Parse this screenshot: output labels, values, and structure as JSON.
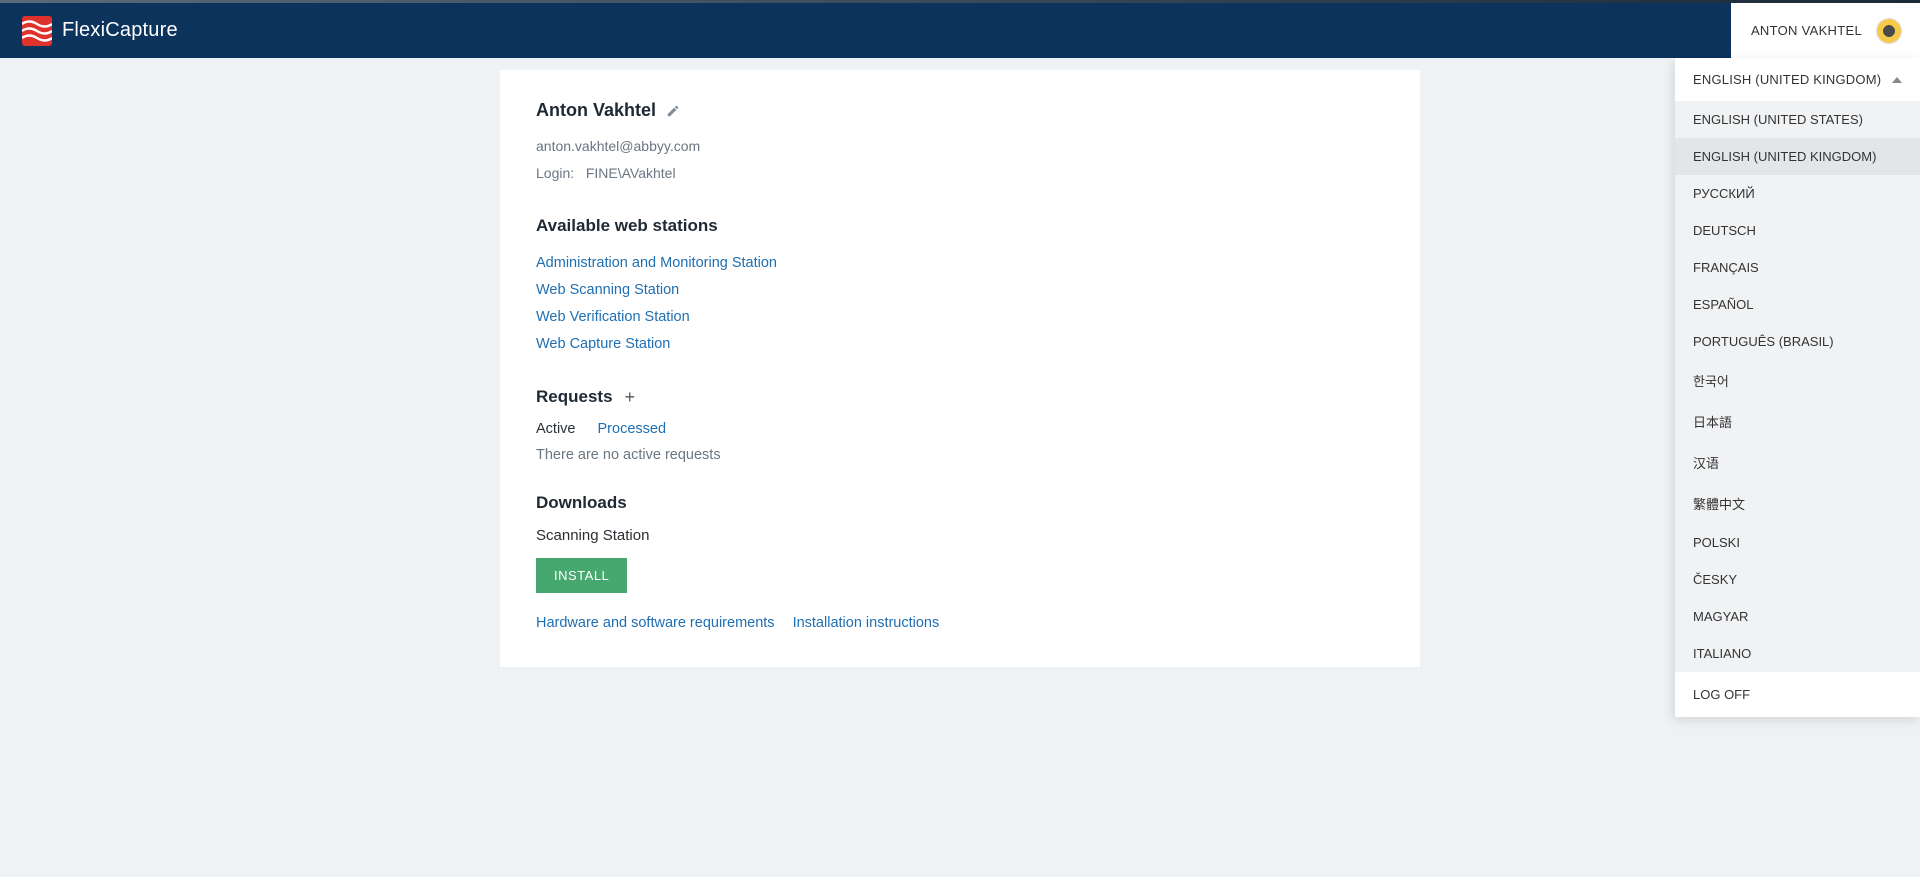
{
  "product_name": "FlexiCapture",
  "header_user": "ANTON VAKHTEL",
  "user": {
    "display_name": "Anton Vakhtel",
    "email": "anton.vakhtel@abbyy.com",
    "login_label": "Login:",
    "login_value": "FINE\\AVakhtel"
  },
  "stations": {
    "title": "Available web stations",
    "items": [
      "Administration and Monitoring Station",
      "Web Scanning Station",
      "Web Verification Station",
      "Web Capture Station"
    ]
  },
  "requests": {
    "title": "Requests",
    "tab_active": "Active",
    "tab_processed": "Processed",
    "empty_text": "There are no active requests"
  },
  "downloads": {
    "title": "Downloads",
    "subtitle": "Scanning Station",
    "install_label": "INSTALL",
    "link_hw": "Hardware and software requirements",
    "link_instr": "Installation instructions"
  },
  "dropdown": {
    "current": "ENGLISH (UNITED KINGDOM)",
    "languages": [
      "ENGLISH (UNITED STATES)",
      "ENGLISH (UNITED KINGDOM)",
      "РУССКИЙ",
      "DEUTSCH",
      "FRANÇAIS",
      "ESPAÑOL",
      "PORTUGUÊS (BRASIL)",
      "한국어",
      "日本語",
      "汉语",
      "繁體中文",
      "POLSKI",
      "ČESKY",
      "MAGYAR",
      "ITALIANO"
    ],
    "selected_index": 1,
    "logoff": "LOG OFF"
  }
}
